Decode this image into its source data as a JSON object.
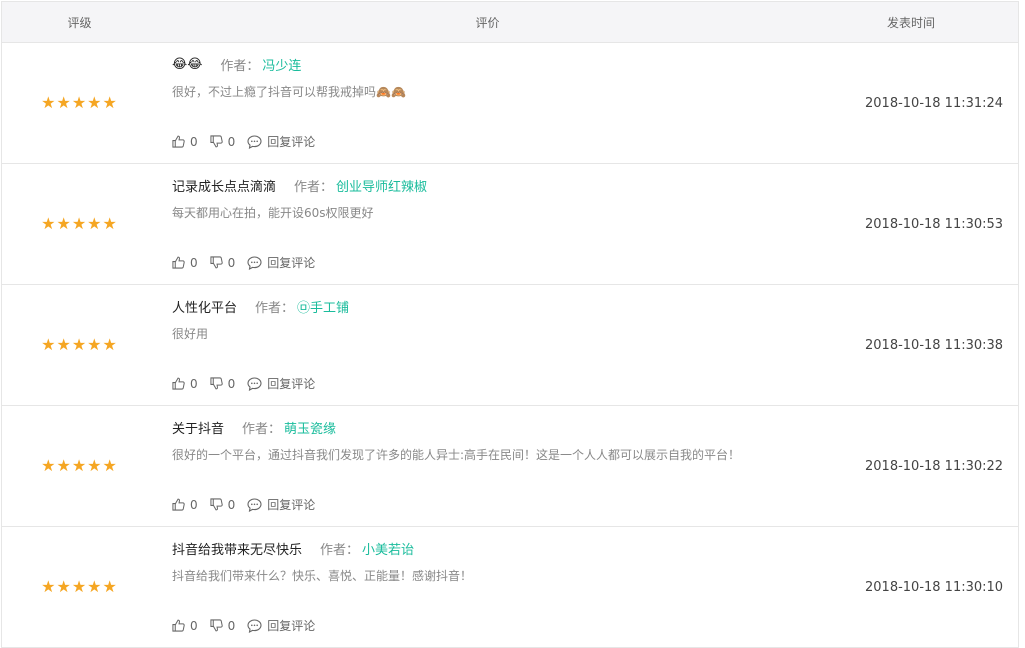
{
  "header": {
    "rating": "评级",
    "review": "评价",
    "time": "发表时间"
  },
  "author_label": "作者：",
  "reply_label": "回复评论",
  "colors": {
    "star": "#f5a623",
    "author": "#1abc9c"
  },
  "reviews": [
    {
      "stars": "★★★★★",
      "title": "😂😂",
      "author": "冯少连",
      "body": "很好，不过上瘾了抖音可以帮我戒掉吗🙈🙈",
      "likes": "0",
      "dislikes": "0",
      "time": "2018-10-18 11:31:24"
    },
    {
      "stars": "★★★★★",
      "title": "记录成长点点滴滴",
      "author": "创业导师红辣椒",
      "body": "每天都用心在拍，能开设60s权限更好",
      "likes": "0",
      "dislikes": "0",
      "time": "2018-10-18 11:30:53"
    },
    {
      "stars": "★★★★★",
      "title": "人性化平台",
      "author": "㉤手工铺",
      "body": "很好用",
      "likes": "0",
      "dislikes": "0",
      "time": "2018-10-18 11:30:38"
    },
    {
      "stars": "★★★★★",
      "title": "关于抖音",
      "author": "萌玉瓷缘",
      "body": "很好的一个平台，通过抖音我们发现了许多的能人异士:高手在民间！这是一个人人都可以展示自我的平台！",
      "likes": "0",
      "dislikes": "0",
      "time": "2018-10-18 11:30:22"
    },
    {
      "stars": "★★★★★",
      "title": "抖音给我带来无尽快乐",
      "author": "小美若诒",
      "body": "抖音给我们带来什么？快乐、喜悦、正能量！感谢抖音！",
      "likes": "0",
      "dislikes": "0",
      "time": "2018-10-18 11:30:10"
    }
  ]
}
